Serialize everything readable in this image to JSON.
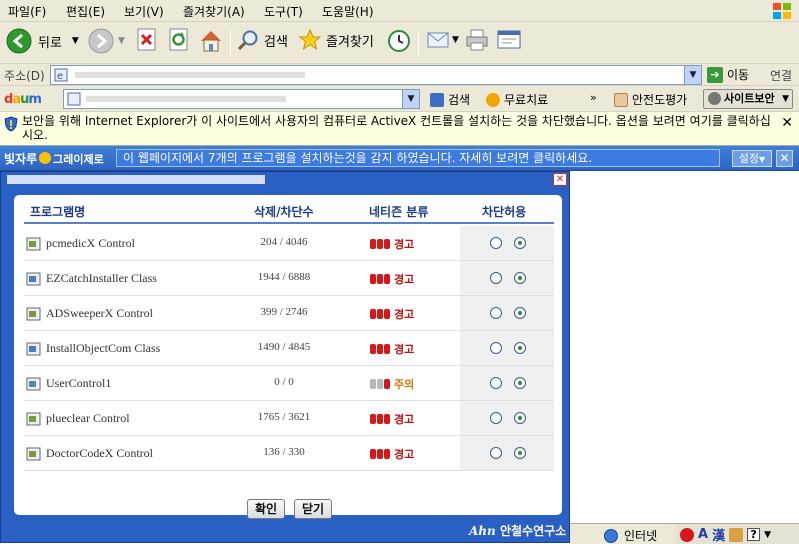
{
  "menu": {
    "items": [
      "파일(F)",
      "편집(E)",
      "보기(V)",
      "즐겨찾기(A)",
      "도구(T)",
      "도움말(H)"
    ]
  },
  "toolbar": {
    "back_label": "뒤로",
    "search_label": "검색",
    "favorites_label": "즐겨찾기"
  },
  "address": {
    "label": "주소(D)",
    "go_label": "이동",
    "links_label": "연결"
  },
  "daum": {
    "search_label": "검색",
    "free_label": "무료치료",
    "safety_label": "안전도평가",
    "site_security_label": "사이트보안"
  },
  "infobar": {
    "text": "보안을 위해 Internet Explorer가 이 사이트에서 사용자의 컴퓨터로 ActiveX 컨트롤을 설치하는 것을 차단했습니다. 옵션을 보려면 여기를 클릭하십시오."
  },
  "notify": {
    "logo_left": "빛자루",
    "logo_right": "그레이제로",
    "message": "이 웹페이지에서 7개의 프로그램을 설치하는것을 감지 하였습니다.  자세히 보려면 클릭하세요.",
    "settings_label": "설정"
  },
  "dialog": {
    "headers": {
      "name": "프로그램명",
      "count": "삭제/차단수",
      "level": "네티즌 분류",
      "action": "차단허용"
    },
    "rows": [
      {
        "name": "pcmedicX Control",
        "count": "204 / 4046",
        "level": "경고",
        "warn": true
      },
      {
        "name": "EZCatchInstaller Class",
        "count": "1944 / 6888",
        "level": "경고",
        "warn": true
      },
      {
        "name": "ADSweeperX Control",
        "count": "399 / 2746",
        "level": "경고",
        "warn": true
      },
      {
        "name": "InstallObjectCom Class",
        "count": "1490 / 4845",
        "level": "경고",
        "warn": true
      },
      {
        "name": "UserControl1",
        "count": "0 / 0",
        "level": "주의",
        "warn": false
      },
      {
        "name": "plueclear Control",
        "count": "1765 / 3621",
        "level": "경고",
        "warn": true
      },
      {
        "name": "DoctorCodeX Control",
        "count": "136 / 330",
        "level": "경고",
        "warn": true
      }
    ],
    "ok_label": "확인",
    "close_label": "닫기",
    "brand": "안철수연구소"
  },
  "status": {
    "zone": "인터넷",
    "ime_a": "A",
    "ime_han": "漢"
  }
}
